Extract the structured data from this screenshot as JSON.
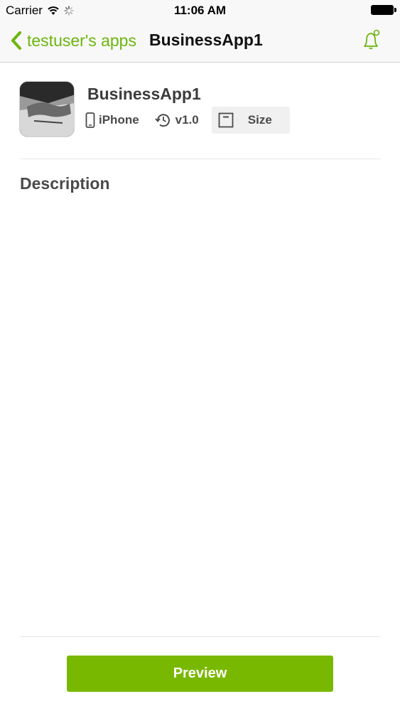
{
  "status_bar": {
    "carrier": "Carrier",
    "time": "11:06 AM"
  },
  "nav": {
    "back_label": "testuser's apps",
    "title": "BusinessApp1",
    "icons": {
      "back": "chevron-left-icon",
      "bell": "bell-icon"
    }
  },
  "app": {
    "name": "BusinessApp1",
    "device": "iPhone",
    "version": "v1.0",
    "size_label": "Size"
  },
  "description": {
    "title": "Description"
  },
  "footer": {
    "preview_label": "Preview"
  },
  "colors": {
    "accent": "#6bb60d",
    "button": "#78b800",
    "text_dark": "#3c3c3c",
    "text_meta": "#4a4a4a"
  }
}
